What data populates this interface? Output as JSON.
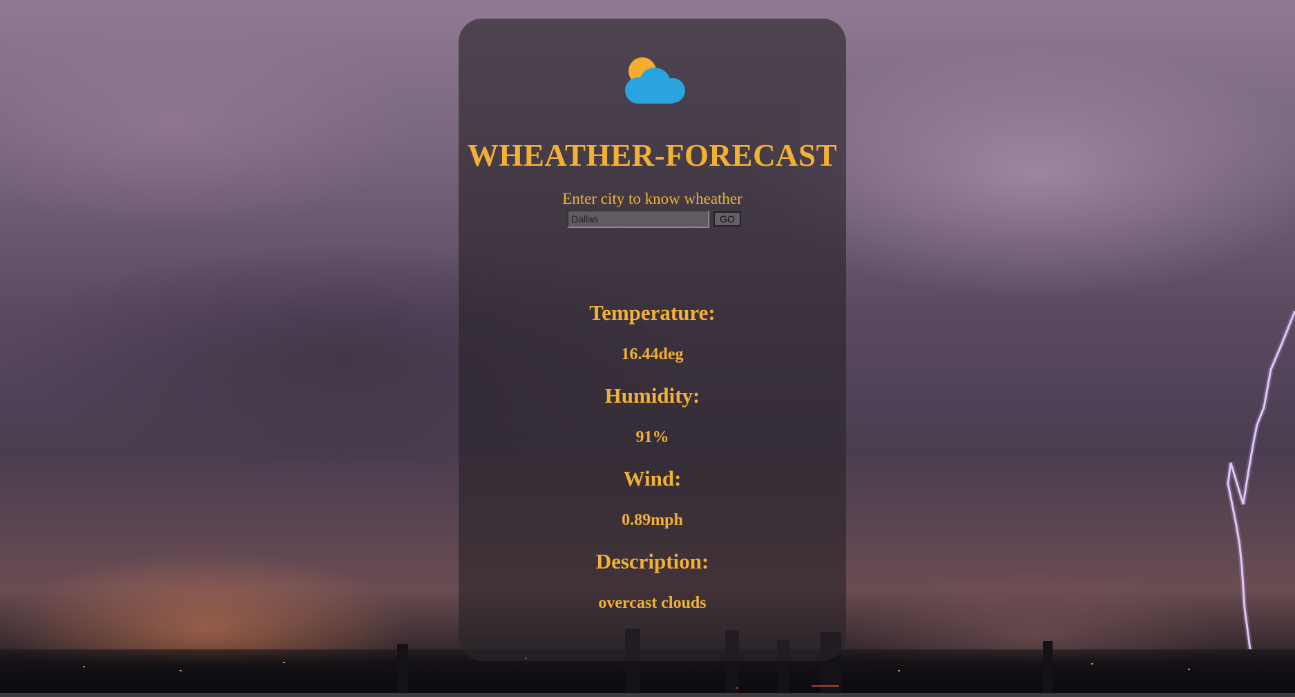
{
  "app": {
    "title": "WHEATHER-FORECAST",
    "logo_icon": "sun-cloud-icon"
  },
  "search": {
    "prompt": "Enter city to know wheather",
    "value": "Dallas",
    "button_label": "GO"
  },
  "weather": {
    "temperature_label": "Temperature:",
    "temperature_value": "16.44deg",
    "humidity_label": "Humidity:",
    "humidity_value": "91%",
    "wind_label": "Wind:",
    "wind_value": "0.89mph",
    "description_label": "Description:",
    "description_value": "overcast clouds"
  },
  "colors": {
    "accent": "#f2b134",
    "cloud": "#2aa4de",
    "sun": "#f4ad2f"
  }
}
